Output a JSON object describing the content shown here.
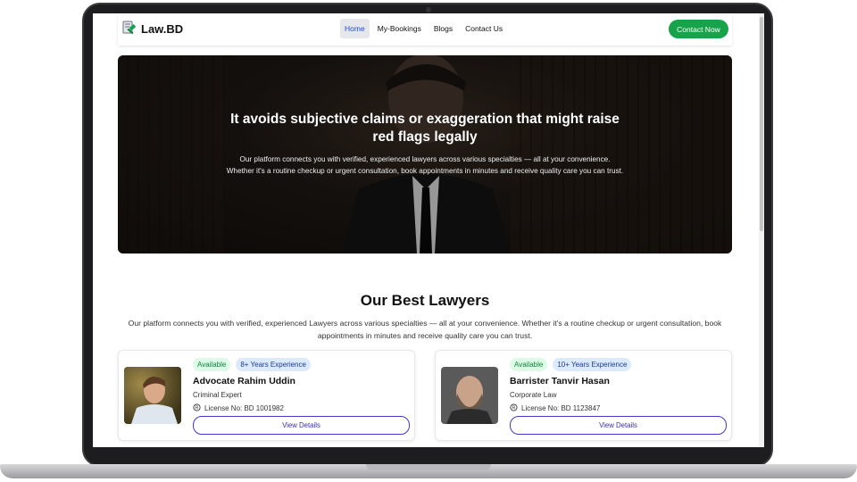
{
  "nav": {
    "brand": "Law.BD",
    "links": [
      {
        "label": "Home",
        "active": true
      },
      {
        "label": "My-Bookings",
        "active": false
      },
      {
        "label": "Blogs",
        "active": false
      },
      {
        "label": "Contact Us",
        "active": false
      }
    ],
    "cta_label": "Contact Now"
  },
  "hero": {
    "title": "It avoids subjective claims or exaggeration that might raise red flags legally",
    "text": "Our platform connects you with verified, experienced lawyers across various specialties — all at your convenience. Whether it's a routine checkup or urgent consultation, book appointments in minutes and receive quality care you can trust."
  },
  "section": {
    "title": "Our Best Lawyers",
    "description": "Our platform connects you with verified, experienced Lawyers across various specialties — all at your convenience. Whether it's a routine checkup or urgent consultation, book appointments in minutes and receive quality care you can trust."
  },
  "lawyers": [
    {
      "status": "Available",
      "experience": "8+ Years Experience",
      "name": "Advocate Rahim Uddin",
      "specialty": "Criminal Expert",
      "license": "License No: BD 1001982",
      "button": "View Details"
    },
    {
      "status": "Available",
      "experience": "10+ Years Experience",
      "name": "Barrister Tanvir Hasan",
      "specialty": "Corporate Law",
      "license": "License No: BD 1123847",
      "button": "View Details"
    }
  ],
  "colors": {
    "accent_green": "#16a34a",
    "accent_blue": "#1d4ed8",
    "button_border": "#4338ca"
  }
}
